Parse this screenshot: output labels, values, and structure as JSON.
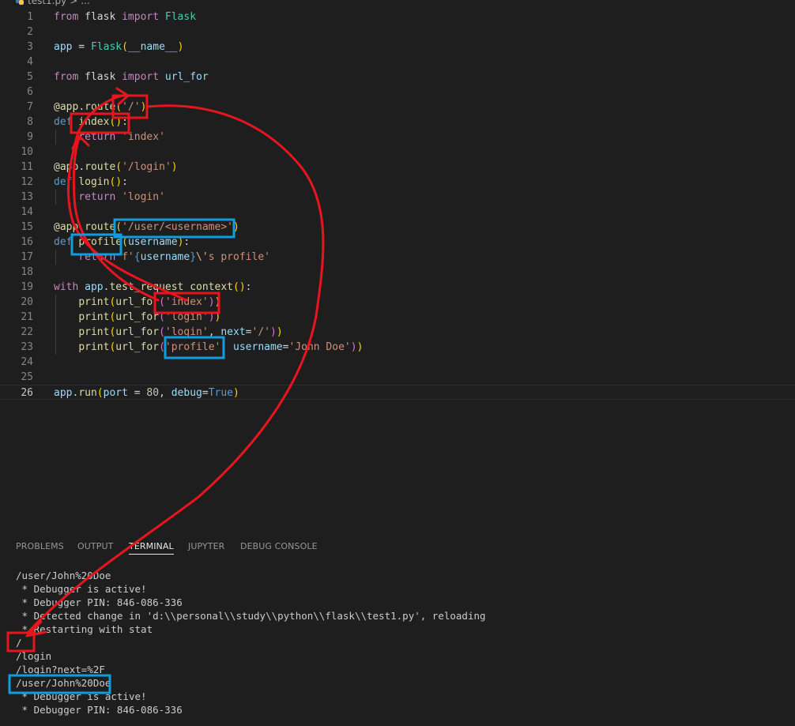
{
  "breadcrumb": {
    "file": "test1.py",
    "separator": ">",
    "trail": "..."
  },
  "editor": {
    "line_numbers": [
      "1",
      "2",
      "3",
      "4",
      "5",
      "6",
      "7",
      "8",
      "9",
      "10",
      "11",
      "12",
      "13",
      "14",
      "15",
      "16",
      "17",
      "18",
      "19",
      "20",
      "21",
      "22",
      "23",
      "24",
      "25",
      "26"
    ],
    "current_line": "26",
    "lines": [
      [
        {
          "t": "from",
          "c": "kw"
        },
        {
          "t": " flask ",
          "c": "plain"
        },
        {
          "t": "import",
          "c": "kw"
        },
        {
          "t": " ",
          "c": "plain"
        },
        {
          "t": "Flask",
          "c": "cls"
        }
      ],
      [],
      [
        {
          "t": "app",
          "c": "var"
        },
        {
          "t": " = ",
          "c": "plain"
        },
        {
          "t": "Flask",
          "c": "cls"
        },
        {
          "t": "(",
          "c": "br1"
        },
        {
          "t": "__name__",
          "c": "var"
        },
        {
          "t": ")",
          "c": "br1"
        }
      ],
      [],
      [
        {
          "t": "from",
          "c": "kw"
        },
        {
          "t": " flask ",
          "c": "plain"
        },
        {
          "t": "import",
          "c": "kw"
        },
        {
          "t": " ",
          "c": "plain"
        },
        {
          "t": "url_for",
          "c": "var"
        }
      ],
      [],
      [
        {
          "t": "@app",
          "c": "fn"
        },
        {
          "t": ".",
          "c": "plain"
        },
        {
          "t": "route",
          "c": "fn"
        },
        {
          "t": "(",
          "c": "br1"
        },
        {
          "t": "'/'",
          "c": "str"
        },
        {
          "t": ")",
          "c": "br1"
        }
      ],
      [
        {
          "t": "def",
          "c": "def"
        },
        {
          "t": " ",
          "c": "plain"
        },
        {
          "t": "index",
          "c": "fn"
        },
        {
          "t": "()",
          "c": "br1"
        },
        {
          "t": ":",
          "c": "plain"
        }
      ],
      [
        {
          "t": "    ",
          "c": "plain"
        },
        {
          "t": "return",
          "c": "kw"
        },
        {
          "t": " ",
          "c": "plain"
        },
        {
          "t": "'index'",
          "c": "str"
        }
      ],
      [],
      [
        {
          "t": "@app",
          "c": "fn"
        },
        {
          "t": ".",
          "c": "plain"
        },
        {
          "t": "route",
          "c": "fn"
        },
        {
          "t": "(",
          "c": "br1"
        },
        {
          "t": "'/login'",
          "c": "str"
        },
        {
          "t": ")",
          "c": "br1"
        }
      ],
      [
        {
          "t": "def",
          "c": "def"
        },
        {
          "t": " ",
          "c": "plain"
        },
        {
          "t": "login",
          "c": "fn"
        },
        {
          "t": "()",
          "c": "br1"
        },
        {
          "t": ":",
          "c": "plain"
        }
      ],
      [
        {
          "t": "    ",
          "c": "plain"
        },
        {
          "t": "return",
          "c": "kw"
        },
        {
          "t": " ",
          "c": "plain"
        },
        {
          "t": "'login'",
          "c": "str"
        }
      ],
      [],
      [
        {
          "t": "@app",
          "c": "fn"
        },
        {
          "t": ".",
          "c": "plain"
        },
        {
          "t": "route",
          "c": "fn"
        },
        {
          "t": "(",
          "c": "br1"
        },
        {
          "t": "'/user/<username>'",
          "c": "str"
        },
        {
          "t": ")",
          "c": "br1"
        }
      ],
      [
        {
          "t": "def",
          "c": "def"
        },
        {
          "t": " ",
          "c": "plain"
        },
        {
          "t": "profile",
          "c": "fn"
        },
        {
          "t": "(",
          "c": "br1"
        },
        {
          "t": "username",
          "c": "var"
        },
        {
          "t": ")",
          "c": "br1"
        },
        {
          "t": ":",
          "c": "plain"
        }
      ],
      [
        {
          "t": "    ",
          "c": "plain"
        },
        {
          "t": "return",
          "c": "kw"
        },
        {
          "t": " ",
          "c": "plain"
        },
        {
          "t": "f'",
          "c": "str"
        },
        {
          "t": "{",
          "c": "def"
        },
        {
          "t": "username",
          "c": "var"
        },
        {
          "t": "}",
          "c": "def"
        },
        {
          "t": "\\'",
          "c": "esc"
        },
        {
          "t": "s profile'",
          "c": "str"
        }
      ],
      [],
      [
        {
          "t": "with",
          "c": "kw"
        },
        {
          "t": " ",
          "c": "plain"
        },
        {
          "t": "app",
          "c": "var"
        },
        {
          "t": ".",
          "c": "plain"
        },
        {
          "t": "test_request_context",
          "c": "fn"
        },
        {
          "t": "()",
          "c": "br1"
        },
        {
          "t": ":",
          "c": "plain"
        }
      ],
      [
        {
          "t": "    ",
          "c": "plain"
        },
        {
          "t": "print",
          "c": "fn"
        },
        {
          "t": "(",
          "c": "br1"
        },
        {
          "t": "url_for",
          "c": "fn"
        },
        {
          "t": "(",
          "c": "br2"
        },
        {
          "t": "'index'",
          "c": "str"
        },
        {
          "t": ")",
          "c": "br2"
        },
        {
          "t": ")",
          "c": "br1"
        }
      ],
      [
        {
          "t": "    ",
          "c": "plain"
        },
        {
          "t": "print",
          "c": "fn"
        },
        {
          "t": "(",
          "c": "br1"
        },
        {
          "t": "url_for",
          "c": "fn"
        },
        {
          "t": "(",
          "c": "br2"
        },
        {
          "t": "'login'",
          "c": "str"
        },
        {
          "t": ")",
          "c": "br2"
        },
        {
          "t": ")",
          "c": "br1"
        }
      ],
      [
        {
          "t": "    ",
          "c": "plain"
        },
        {
          "t": "print",
          "c": "fn"
        },
        {
          "t": "(",
          "c": "br1"
        },
        {
          "t": "url_for",
          "c": "fn"
        },
        {
          "t": "(",
          "c": "br2"
        },
        {
          "t": "'login'",
          "c": "str"
        },
        {
          "t": ", ",
          "c": "plain"
        },
        {
          "t": "next",
          "c": "var"
        },
        {
          "t": "=",
          "c": "plain"
        },
        {
          "t": "'/'",
          "c": "str"
        },
        {
          "t": ")",
          "c": "br2"
        },
        {
          "t": ")",
          "c": "br1"
        }
      ],
      [
        {
          "t": "    ",
          "c": "plain"
        },
        {
          "t": "print",
          "c": "fn"
        },
        {
          "t": "(",
          "c": "br1"
        },
        {
          "t": "url_for",
          "c": "fn"
        },
        {
          "t": "(",
          "c": "br2"
        },
        {
          "t": "'profile'",
          "c": "str"
        },
        {
          "t": ", ",
          "c": "plain"
        },
        {
          "t": "username",
          "c": "var"
        },
        {
          "t": "=",
          "c": "plain"
        },
        {
          "t": "'John Doe'",
          "c": "str"
        },
        {
          "t": ")",
          "c": "br2"
        },
        {
          "t": ")",
          "c": "br1"
        }
      ],
      [],
      [],
      [
        {
          "t": "app",
          "c": "var"
        },
        {
          "t": ".",
          "c": "plain"
        },
        {
          "t": "run",
          "c": "fn"
        },
        {
          "t": "(",
          "c": "br1"
        },
        {
          "t": "port",
          "c": "var"
        },
        {
          "t": " = ",
          "c": "plain"
        },
        {
          "t": "80",
          "c": "num"
        },
        {
          "t": ", ",
          "c": "plain"
        },
        {
          "t": "debug",
          "c": "var"
        },
        {
          "t": "=",
          "c": "plain"
        },
        {
          "t": "True",
          "c": "def"
        },
        {
          "t": ")",
          "c": "br1"
        }
      ]
    ]
  },
  "panel": {
    "tabs": [
      "PROBLEMS",
      "OUTPUT",
      "TERMINAL",
      "JUPYTER",
      "DEBUG CONSOLE"
    ],
    "active_tab": "TERMINAL"
  },
  "terminal": {
    "lines": [
      "/user/John%20Doe",
      " * Debugger is active!",
      " * Debugger PIN: 846-086-336",
      " * Detected change in 'd:\\\\personal\\\\study\\\\python\\\\flask\\\\test1.py', reloading",
      " * Restarting with stat",
      "/",
      "/login",
      "/login?next=%2F",
      "/user/John%20Doe",
      " * Debugger is active!",
      " * Debugger PIN: 846-086-336"
    ]
  },
  "annotations": {
    "red_color": "#e8141e",
    "blue_color": "#0f9de0"
  }
}
